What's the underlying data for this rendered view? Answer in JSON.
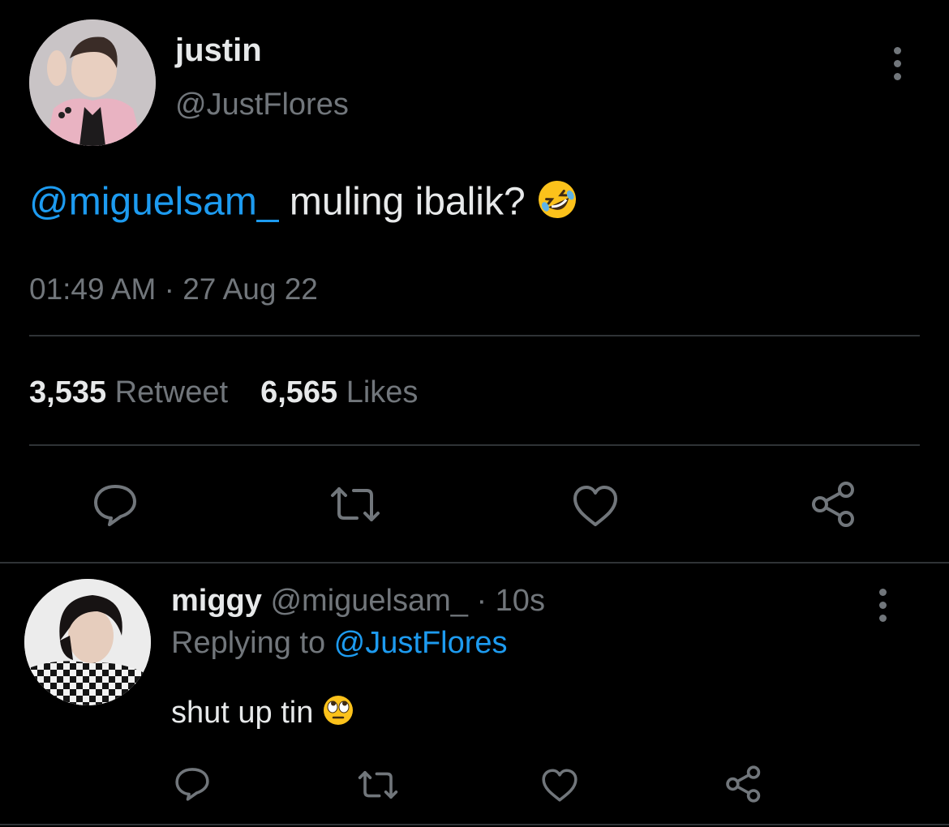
{
  "main_tweet": {
    "author": {
      "display_name": "justin",
      "handle": "@JustFlores",
      "avatar": "profile-photo"
    },
    "text": {
      "mention": "@miguelsam_",
      "body": " muling ibalik? ",
      "emoji": "rolling-on-floor-laughing-emoji"
    },
    "timestamp": "01:49 AM · 27 Aug 22",
    "stats": {
      "retweets_count": "3,535",
      "retweets_label": "Retweet",
      "likes_count": "6,565",
      "likes_label": "Likes"
    },
    "actions": [
      "reply-icon",
      "retweet-icon",
      "like-icon",
      "share-icon"
    ]
  },
  "reply_tweet": {
    "author": {
      "display_name": "miggy",
      "handle": "@miguelsam_",
      "time": " · 10s",
      "avatar": "profile-photo"
    },
    "replying_prefix": "Replying to ",
    "replying_to": "@JustFlores",
    "text": "shut up tin ",
    "emoji": "face-with-rolling-eyes-emoji",
    "actions": [
      "reply-icon",
      "retweet-icon",
      "like-icon",
      "share-icon"
    ]
  },
  "colors": {
    "background": "#000000",
    "primary_text": "#e7e9ea",
    "secondary_text": "#71767b",
    "accent": "#1d9bf0",
    "divider": "#2f3336"
  }
}
